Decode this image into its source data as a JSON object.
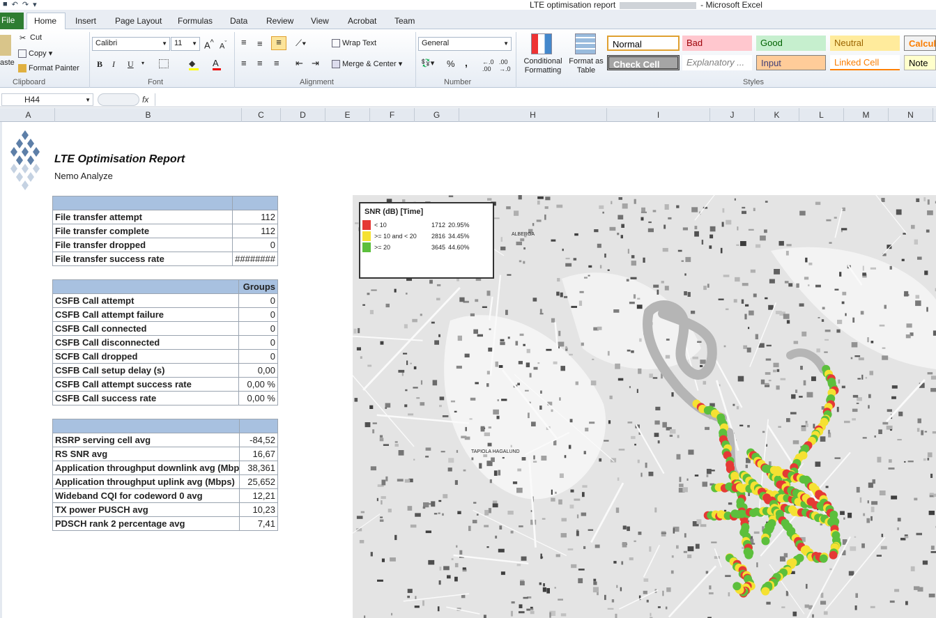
{
  "window": {
    "title": "LTE optimisation report",
    "app": "Microsoft Excel"
  },
  "tabs": [
    "File",
    "Home",
    "Insert",
    "Page Layout",
    "Formulas",
    "Data",
    "Review",
    "View",
    "Acrobat",
    "Team"
  ],
  "ribbon": {
    "clipboard": {
      "paste": "aste",
      "cut": "Cut",
      "copy": "Copy",
      "format_painter": "Format Painter",
      "label": "Clipboard"
    },
    "font": {
      "family": "Calibri",
      "size": "11",
      "label": "Font",
      "bold": "B",
      "italic": "I",
      "underline": "U"
    },
    "alignment": {
      "wrap": "Wrap Text",
      "merge": "Merge & Center",
      "label": "Alignment"
    },
    "number": {
      "format": "General",
      "label": "Number",
      "pct": "%",
      "comma": ","
    },
    "styles": {
      "conditional": "Conditional Formatting",
      "format_table": "Format as Table",
      "label": "Styles",
      "cells": [
        {
          "name": "Normal",
          "bg": "#ffffff",
          "fg": "#000000",
          "border": "#e0a030"
        },
        {
          "name": "Bad",
          "bg": "#ffc7ce",
          "fg": "#9c0006"
        },
        {
          "name": "Good",
          "bg": "#c6efce",
          "fg": "#006100"
        },
        {
          "name": "Neutral",
          "bg": "#ffeb9c",
          "fg": "#9c6500"
        },
        {
          "name": "Calcula",
          "bg": "#f2f2f2",
          "fg": "#fa7d00"
        },
        {
          "name": "Check Cell",
          "bg": "#a5a5a5",
          "fg": "#ffffff"
        },
        {
          "name": "Explanatory ...",
          "bg": "#ffffff",
          "fg": "#7f7f7f"
        },
        {
          "name": "Input",
          "bg": "#ffcc99",
          "fg": "#3f3f76"
        },
        {
          "name": "Linked Cell",
          "bg": "#ffffff",
          "fg": "#fa7d00"
        },
        {
          "name": "Note",
          "bg": "#ffffcc",
          "fg": "#000000"
        }
      ]
    }
  },
  "formula_bar": {
    "name_box": "H44",
    "fx": "fx",
    "value": ""
  },
  "columns": [
    "A",
    "B",
    "C",
    "D",
    "E",
    "F",
    "G",
    "H",
    "I",
    "J",
    "K",
    "L",
    "M",
    "N"
  ],
  "report": {
    "title": "LTE Optimisation Report",
    "subtitle": "Nemo Analyze"
  },
  "table1": {
    "header": [
      "",
      ""
    ],
    "rows": [
      [
        "File transfer attempt",
        "112"
      ],
      [
        "File transfer complete",
        "112"
      ],
      [
        "File transfer dropped",
        "0"
      ],
      [
        "File transfer success rate",
        "########"
      ]
    ]
  },
  "table2": {
    "header": [
      "",
      "Groups"
    ],
    "rows": [
      [
        "CSFB Call attempt",
        "0"
      ],
      [
        "CSFB Call attempt failure",
        "0"
      ],
      [
        "CSFB Call connected",
        "0"
      ],
      [
        "CSFB Call disconnected",
        "0"
      ],
      [
        "SCFB Call dropped",
        "0"
      ],
      [
        "CSFB Call setup delay (s)",
        "0,00"
      ],
      [
        "CSFB Call attempt success rate",
        "0,00 %"
      ],
      [
        "CSFB Call success rate",
        "0,00 %"
      ]
    ]
  },
  "table3": {
    "header": [
      "",
      ""
    ],
    "rows": [
      [
        "RSRP serving cell avg",
        "-84,52"
      ],
      [
        "RS SNR avg",
        "16,67"
      ],
      [
        "Application throughput downlink avg (Mbp",
        "38,361"
      ],
      [
        "Application throughput uplink avg (Mbps)",
        "25,652"
      ],
      [
        "Wideband CQI for codeword 0 avg",
        "12,21"
      ],
      [
        "TX power PUSCH avg",
        "10,23"
      ],
      [
        "PDSCH rank 2 percentage avg",
        "7,41"
      ]
    ]
  },
  "map": {
    "labels": [
      "ALBERGA",
      "TAPIOLA HAGALUND"
    ],
    "legend": {
      "title": "SNR (dB) [Time]",
      "items": [
        {
          "label": "< 10",
          "count": "1712",
          "pct": "20.95%",
          "color": "#e53935"
        },
        {
          "label": ">= 10 and < 20",
          "count": "2816",
          "pct": "34.45%",
          "color": "#f5e132"
        },
        {
          "label": ">= 20",
          "count": "3645",
          "pct": "44.60%",
          "color": "#5cbf3c"
        }
      ]
    }
  }
}
